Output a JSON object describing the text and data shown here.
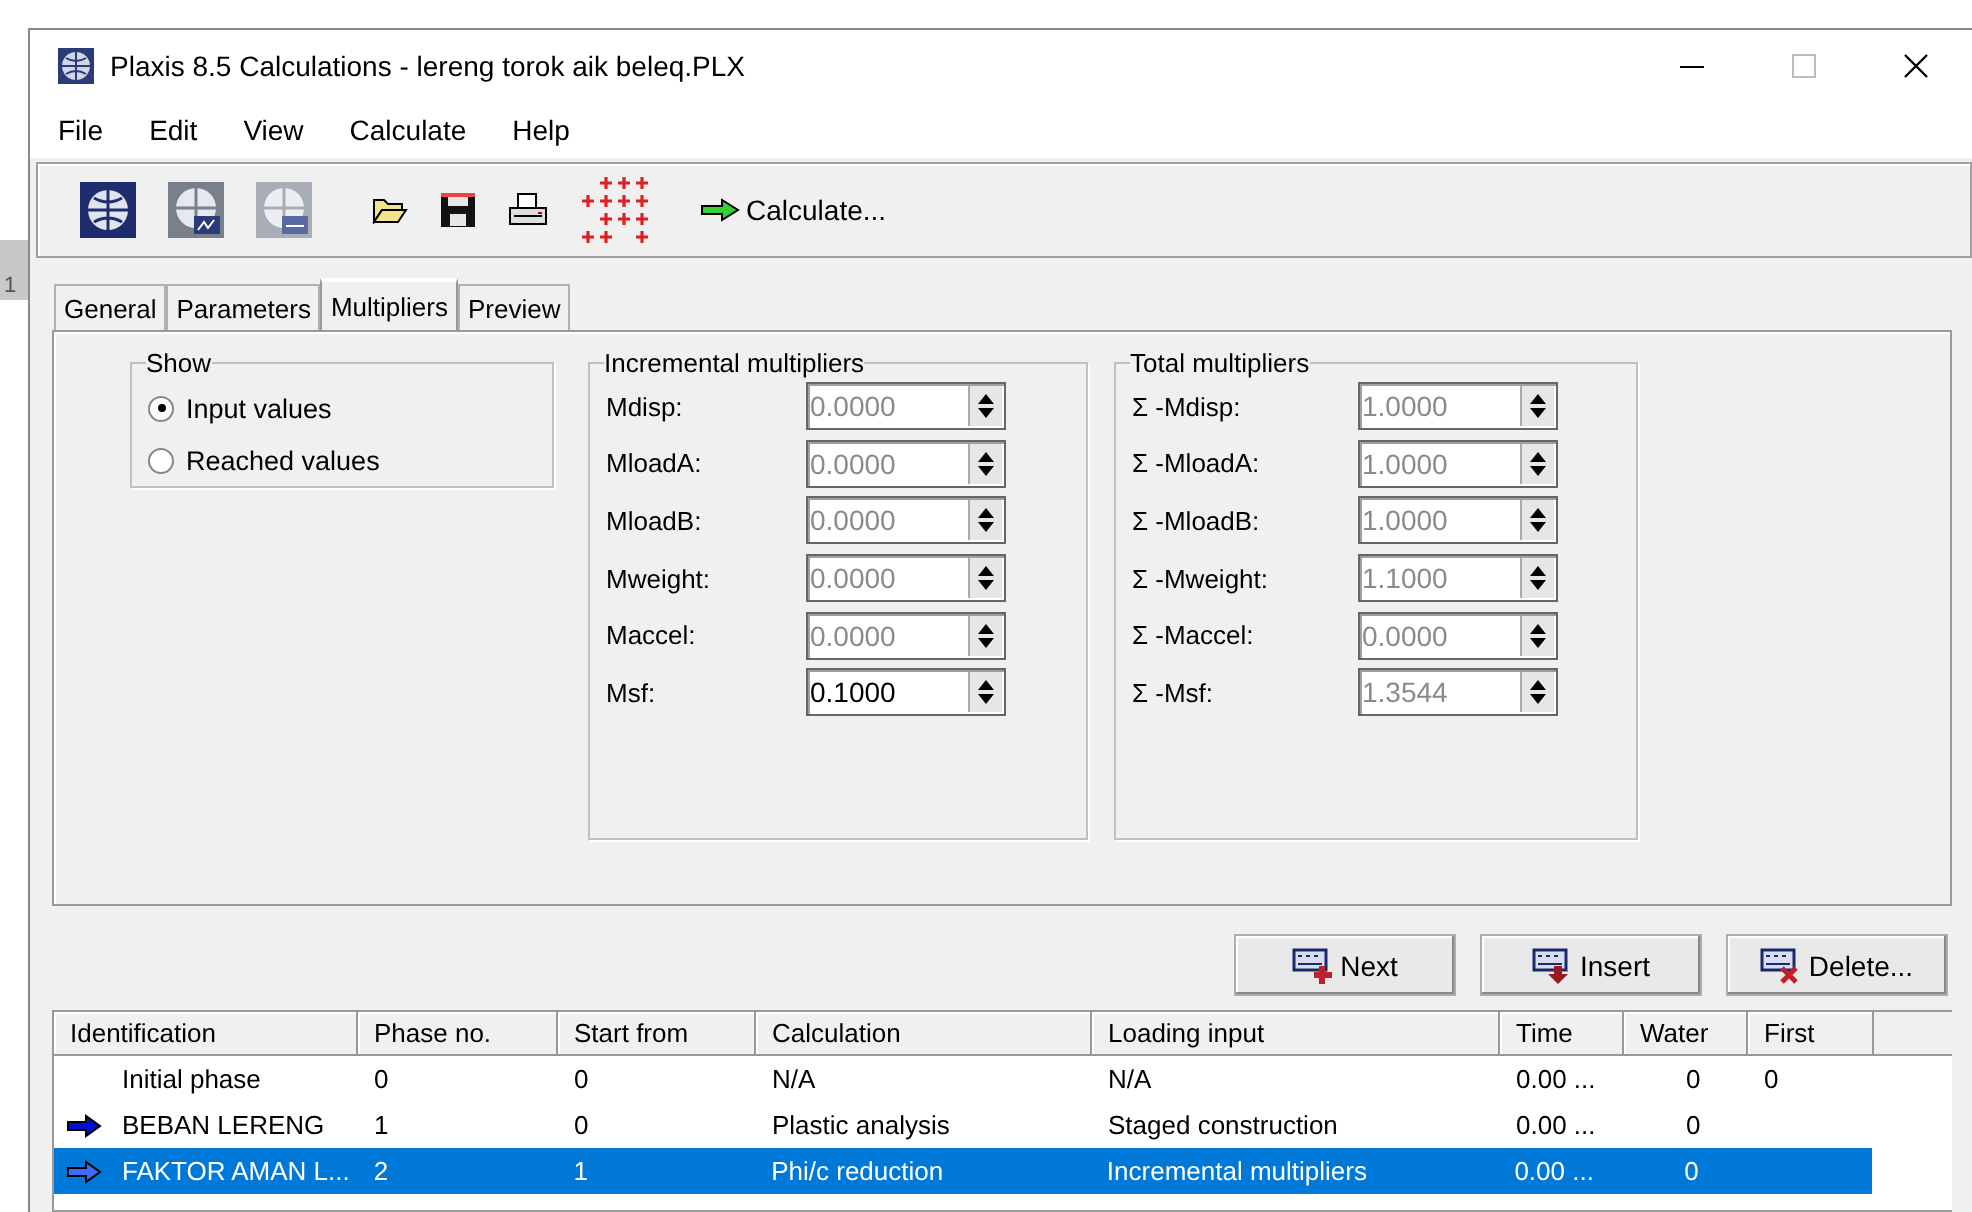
{
  "side_text": "1",
  "window": {
    "title": "Plaxis 8.5 Calculations - lereng torok aik beleq.PLX",
    "controls": [
      {
        "kind": "minimize",
        "disabled": false
      },
      {
        "kind": "maximize",
        "disabled": true
      },
      {
        "kind": "close",
        "disabled": false
      }
    ]
  },
  "menu": [
    "File",
    "Edit",
    "View",
    "Calculate",
    "Help"
  ],
  "toolbar": {
    "calculate_label": "Calculate..."
  },
  "tabs": [
    {
      "label": "General",
      "selected": false
    },
    {
      "label": "Parameters",
      "selected": false
    },
    {
      "label": "Multipliers",
      "selected": true
    },
    {
      "label": "Preview",
      "selected": false
    }
  ],
  "show": {
    "title": "Show",
    "options": [
      {
        "label": "Input values",
        "selected": true
      },
      {
        "label": "Reached values",
        "selected": false
      }
    ]
  },
  "incremental": {
    "title": "Incremental multipliers",
    "fields": [
      {
        "label": "Mdisp:",
        "value": "0.0000",
        "disabled": true
      },
      {
        "label": "MloadA:",
        "value": "0.0000",
        "disabled": true
      },
      {
        "label": "MloadB:",
        "value": "0.0000",
        "disabled": true
      },
      {
        "label": "Mweight:",
        "value": "0.0000",
        "disabled": true
      },
      {
        "label": "Maccel:",
        "value": "0.0000",
        "disabled": true
      },
      {
        "label": "Msf:",
        "value": "0.1000",
        "disabled": false
      }
    ]
  },
  "total": {
    "title": "Total multipliers",
    "fields": [
      {
        "label": "Σ -Mdisp:",
        "value": "1.0000",
        "disabled": true
      },
      {
        "label": "Σ -MloadA:",
        "value": "1.0000",
        "disabled": true
      },
      {
        "label": "Σ -MloadB:",
        "value": "1.0000",
        "disabled": true
      },
      {
        "label": "Σ -Mweight:",
        "value": "1.1000",
        "disabled": true
      },
      {
        "label": "Σ -Maccel:",
        "value": "0.0000",
        "disabled": true
      },
      {
        "label": "Σ -Msf:",
        "value": "1.3544",
        "disabled": true
      }
    ]
  },
  "buttons": [
    {
      "kind": "next",
      "label": "Next"
    },
    {
      "kind": "insert",
      "label": "Insert"
    },
    {
      "kind": "delete",
      "label": "Delete..."
    }
  ],
  "table": {
    "columns": [
      "Identification",
      "Phase no.",
      "Start from",
      "Calculation",
      "Loading input",
      "Time",
      "Water",
      "First"
    ],
    "rows": [
      {
        "arrow": false,
        "selected": false,
        "cells": [
          "Initial phase",
          "0",
          "0",
          "N/A",
          "N/A",
          "0.00 ...",
          "0",
          "0"
        ]
      },
      {
        "arrow": true,
        "selected": false,
        "cells": [
          "BEBAN LERENG",
          "1",
          "0",
          "Plastic analysis",
          "Staged construction",
          "0.00 ...",
          "0",
          ""
        ]
      },
      {
        "arrow": true,
        "selected": true,
        "cells": [
          "FAKTOR AMAN L...",
          "2",
          "1",
          "Phi/c reduction",
          "Incremental multipliers",
          "0.00 ...",
          "0",
          ""
        ]
      }
    ]
  }
}
